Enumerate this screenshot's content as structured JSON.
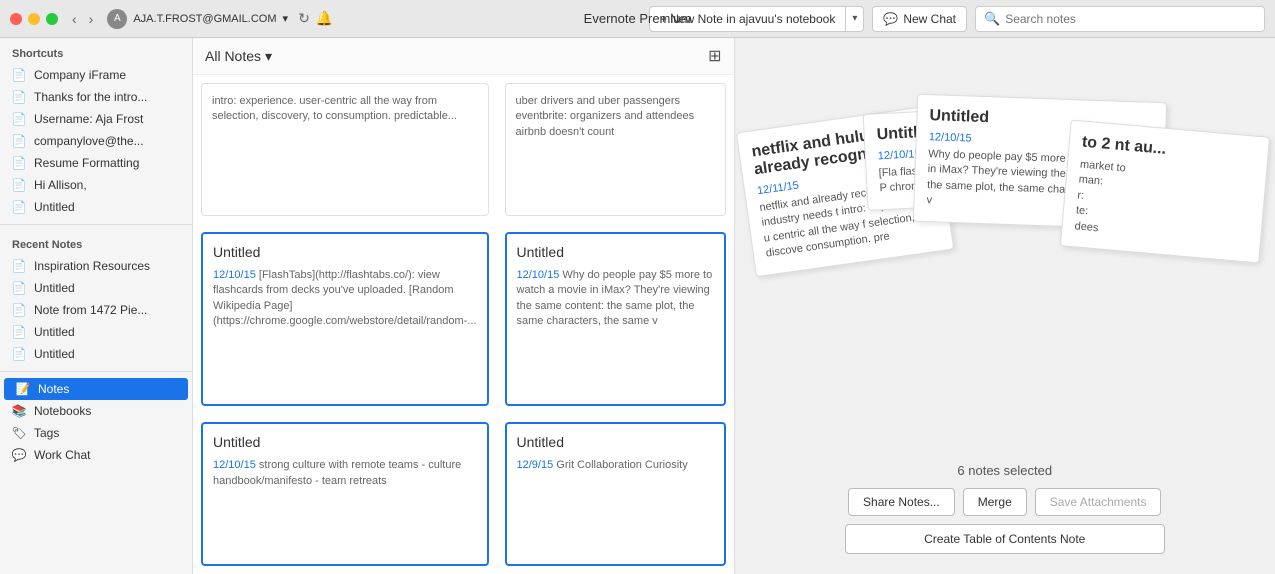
{
  "app": {
    "title": "Evernote Premium"
  },
  "titlebar": {
    "account": "AJA.T.FROST@GMAIL.COM",
    "new_note_label": "+ New Note in ajavuu's notebook",
    "new_note_dropdown": "▾",
    "new_chat_label": "New Chat",
    "search_placeholder": "Search notes"
  },
  "sidebar": {
    "shortcuts_title": "Shortcuts",
    "shortcuts": [
      {
        "id": "company-iframe",
        "label": "Company iFrame"
      },
      {
        "id": "thanks-intro",
        "label": "Thanks for the intro..."
      },
      {
        "id": "username",
        "label": "Username: Aja Frost"
      },
      {
        "id": "companylove",
        "label": "companylove@the..."
      },
      {
        "id": "resume-formatting",
        "label": "Resume Formatting"
      },
      {
        "id": "hi-allison",
        "label": "Hi Allison,"
      },
      {
        "id": "untitled-shortcut",
        "label": "Untitled"
      }
    ],
    "recent_title": "Recent Notes",
    "recent": [
      {
        "id": "inspiration",
        "label": "Inspiration Resources"
      },
      {
        "id": "untitled1",
        "label": "Untitled"
      },
      {
        "id": "note-1472",
        "label": "Note from 1472 Pie..."
      },
      {
        "id": "untitled2",
        "label": "Untitled"
      },
      {
        "id": "untitled3",
        "label": "Untitled"
      }
    ],
    "nav_items": [
      {
        "id": "notes",
        "label": "Notes",
        "active": true
      },
      {
        "id": "notebooks",
        "label": "Notebooks"
      },
      {
        "id": "tags",
        "label": "Tags"
      },
      {
        "id": "work-chat",
        "label": "Work Chat"
      }
    ]
  },
  "notes_header": {
    "title": "All Notes",
    "dropdown_icon": "▾"
  },
  "notes": [
    {
      "id": "note-top-1",
      "title": "",
      "excerpt": "intro: experience. user-centric all the way from selection, discovery, to consumption. predictable...",
      "date": "",
      "selected": false,
      "top_card": true
    },
    {
      "id": "note-top-2",
      "title": "",
      "excerpt": "uber drivers and uber passengers eventbrite: organizers and attendees airbnb doesn't count",
      "date": "",
      "selected": false,
      "top_card": true
    },
    {
      "id": "note-1",
      "title": "Untitled",
      "date": "12/10/15",
      "excerpt": "[FlashTabs](http://flashtabs.co/): view flashcards from decks you've uploaded. [Random Wikipedia Page](https://chrome.google.com/webstore/detail/random-...",
      "selected": true
    },
    {
      "id": "note-2",
      "title": "Untitled",
      "date": "12/10/15",
      "excerpt": "Why do people pay $5 more to watch a movie in iMax? They're viewing the same content: the same plot, the same characters, the same v",
      "selected": true
    },
    {
      "id": "note-3",
      "title": "Untitled",
      "date": "12/10/15",
      "excerpt": "strong culture with remote teams - culture handbook/manifesto - team retreats",
      "selected": true
    },
    {
      "id": "note-4",
      "title": "Untitled",
      "date": "12/9/15",
      "excerpt": "Grit Collaboration Curiosity",
      "selected": true
    }
  ],
  "stacked_cards": [
    {
      "id": "sc1",
      "title": "netflix and hulu already recognize...",
      "date": "12/11/15",
      "text": "netflix and already recognize,th the industry needs t intro: experience. u centric all the way f selection, discove consumption. pre"
    },
    {
      "id": "sc2",
      "title": "Untitled",
      "date": "12/10/15",
      "text": "[Fla flashtabs.co you've uploa Wikipedia P chrome.goo webstore/de"
    },
    {
      "id": "sc3",
      "title": "Untitled",
      "date": "12/10/15",
      "text": "Why do people pay $5 more to watch a movie in iMax? They're viewing the same content: the same plot, the same characters, the same v"
    },
    {
      "id": "sc4",
      "title": "to 2\nnt au...",
      "date": "",
      "text": "market to\n\nman:\nr:\nte:\ndees"
    }
  ],
  "bottom": {
    "selected_label": "6 notes selected",
    "share_btn": "Share Notes...",
    "merge_btn": "Merge",
    "save_attachments_btn": "Save Attachments",
    "create_toc_btn": "Create Table of Contents Note"
  }
}
